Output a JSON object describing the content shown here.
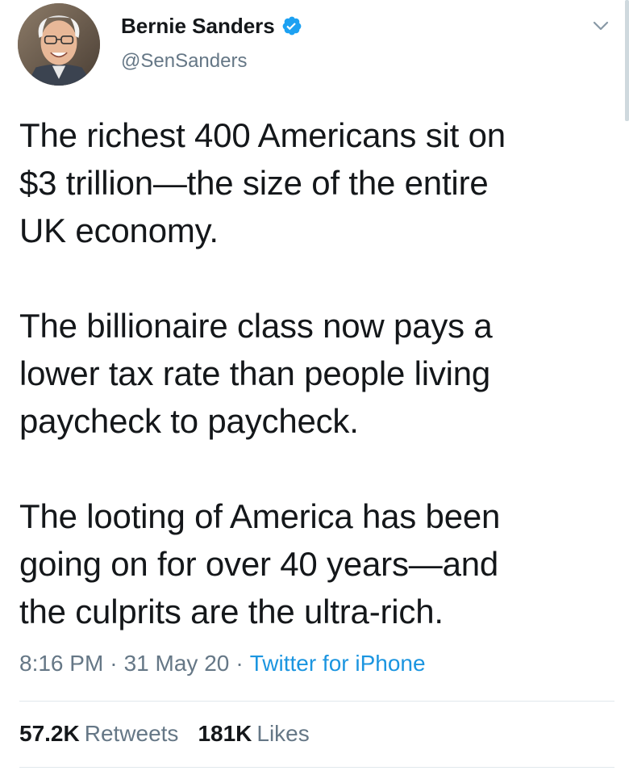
{
  "user": {
    "display_name": "Bernie Sanders",
    "handle": "@SenSanders",
    "verified": true,
    "avatar": "profile-photo"
  },
  "tweet": {
    "text": "The richest 400 Americans sit on\n$3 trillion—the size of the entire\nUK economy.\n\nThe billionaire class now pays a\nlower tax rate than people living\npaycheck to paycheck.\n\nThe looting of America has been\ngoing on for over 40 years—and\nthe culprits are the ultra-rich.",
    "time": "8:16 PM",
    "date": "31 May 20",
    "separator": "·",
    "source": "Twitter for iPhone"
  },
  "stats": {
    "retweets_count": "57.2K",
    "retweets_label": "Retweets",
    "likes_count": "181K",
    "likes_label": "Likes"
  },
  "colors": {
    "text": "#14171a",
    "secondary": "#657786",
    "link": "#1b95e0",
    "verified": "#1da1f2"
  },
  "icons": {
    "verified": "verified-badge-icon",
    "caret": "chevron-down-icon"
  }
}
